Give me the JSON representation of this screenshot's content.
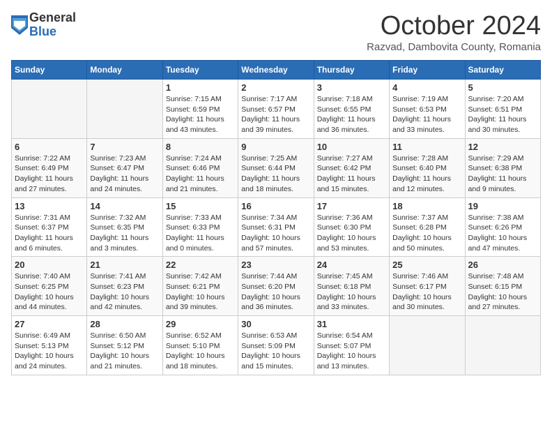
{
  "header": {
    "logo_general": "General",
    "logo_blue": "Blue",
    "month_title": "October 2024",
    "location": "Razvad, Dambovita County, Romania"
  },
  "days_of_week": [
    "Sunday",
    "Monday",
    "Tuesday",
    "Wednesday",
    "Thursday",
    "Friday",
    "Saturday"
  ],
  "weeks": [
    [
      {
        "num": "",
        "info": ""
      },
      {
        "num": "",
        "info": ""
      },
      {
        "num": "1",
        "info": "Sunrise: 7:15 AM\nSunset: 6:59 PM\nDaylight: 11 hours and 43 minutes."
      },
      {
        "num": "2",
        "info": "Sunrise: 7:17 AM\nSunset: 6:57 PM\nDaylight: 11 hours and 39 minutes."
      },
      {
        "num": "3",
        "info": "Sunrise: 7:18 AM\nSunset: 6:55 PM\nDaylight: 11 hours and 36 minutes."
      },
      {
        "num": "4",
        "info": "Sunrise: 7:19 AM\nSunset: 6:53 PM\nDaylight: 11 hours and 33 minutes."
      },
      {
        "num": "5",
        "info": "Sunrise: 7:20 AM\nSunset: 6:51 PM\nDaylight: 11 hours and 30 minutes."
      }
    ],
    [
      {
        "num": "6",
        "info": "Sunrise: 7:22 AM\nSunset: 6:49 PM\nDaylight: 11 hours and 27 minutes."
      },
      {
        "num": "7",
        "info": "Sunrise: 7:23 AM\nSunset: 6:47 PM\nDaylight: 11 hours and 24 minutes."
      },
      {
        "num": "8",
        "info": "Sunrise: 7:24 AM\nSunset: 6:46 PM\nDaylight: 11 hours and 21 minutes."
      },
      {
        "num": "9",
        "info": "Sunrise: 7:25 AM\nSunset: 6:44 PM\nDaylight: 11 hours and 18 minutes."
      },
      {
        "num": "10",
        "info": "Sunrise: 7:27 AM\nSunset: 6:42 PM\nDaylight: 11 hours and 15 minutes."
      },
      {
        "num": "11",
        "info": "Sunrise: 7:28 AM\nSunset: 6:40 PM\nDaylight: 11 hours and 12 minutes."
      },
      {
        "num": "12",
        "info": "Sunrise: 7:29 AM\nSunset: 6:38 PM\nDaylight: 11 hours and 9 minutes."
      }
    ],
    [
      {
        "num": "13",
        "info": "Sunrise: 7:31 AM\nSunset: 6:37 PM\nDaylight: 11 hours and 6 minutes."
      },
      {
        "num": "14",
        "info": "Sunrise: 7:32 AM\nSunset: 6:35 PM\nDaylight: 11 hours and 3 minutes."
      },
      {
        "num": "15",
        "info": "Sunrise: 7:33 AM\nSunset: 6:33 PM\nDaylight: 11 hours and 0 minutes."
      },
      {
        "num": "16",
        "info": "Sunrise: 7:34 AM\nSunset: 6:31 PM\nDaylight: 10 hours and 57 minutes."
      },
      {
        "num": "17",
        "info": "Sunrise: 7:36 AM\nSunset: 6:30 PM\nDaylight: 10 hours and 53 minutes."
      },
      {
        "num": "18",
        "info": "Sunrise: 7:37 AM\nSunset: 6:28 PM\nDaylight: 10 hours and 50 minutes."
      },
      {
        "num": "19",
        "info": "Sunrise: 7:38 AM\nSunset: 6:26 PM\nDaylight: 10 hours and 47 minutes."
      }
    ],
    [
      {
        "num": "20",
        "info": "Sunrise: 7:40 AM\nSunset: 6:25 PM\nDaylight: 10 hours and 44 minutes."
      },
      {
        "num": "21",
        "info": "Sunrise: 7:41 AM\nSunset: 6:23 PM\nDaylight: 10 hours and 42 minutes."
      },
      {
        "num": "22",
        "info": "Sunrise: 7:42 AM\nSunset: 6:21 PM\nDaylight: 10 hours and 39 minutes."
      },
      {
        "num": "23",
        "info": "Sunrise: 7:44 AM\nSunset: 6:20 PM\nDaylight: 10 hours and 36 minutes."
      },
      {
        "num": "24",
        "info": "Sunrise: 7:45 AM\nSunset: 6:18 PM\nDaylight: 10 hours and 33 minutes."
      },
      {
        "num": "25",
        "info": "Sunrise: 7:46 AM\nSunset: 6:17 PM\nDaylight: 10 hours and 30 minutes."
      },
      {
        "num": "26",
        "info": "Sunrise: 7:48 AM\nSunset: 6:15 PM\nDaylight: 10 hours and 27 minutes."
      }
    ],
    [
      {
        "num": "27",
        "info": "Sunrise: 6:49 AM\nSunset: 5:13 PM\nDaylight: 10 hours and 24 minutes."
      },
      {
        "num": "28",
        "info": "Sunrise: 6:50 AM\nSunset: 5:12 PM\nDaylight: 10 hours and 21 minutes."
      },
      {
        "num": "29",
        "info": "Sunrise: 6:52 AM\nSunset: 5:10 PM\nDaylight: 10 hours and 18 minutes."
      },
      {
        "num": "30",
        "info": "Sunrise: 6:53 AM\nSunset: 5:09 PM\nDaylight: 10 hours and 15 minutes."
      },
      {
        "num": "31",
        "info": "Sunrise: 6:54 AM\nSunset: 5:07 PM\nDaylight: 10 hours and 13 minutes."
      },
      {
        "num": "",
        "info": ""
      },
      {
        "num": "",
        "info": ""
      }
    ]
  ]
}
